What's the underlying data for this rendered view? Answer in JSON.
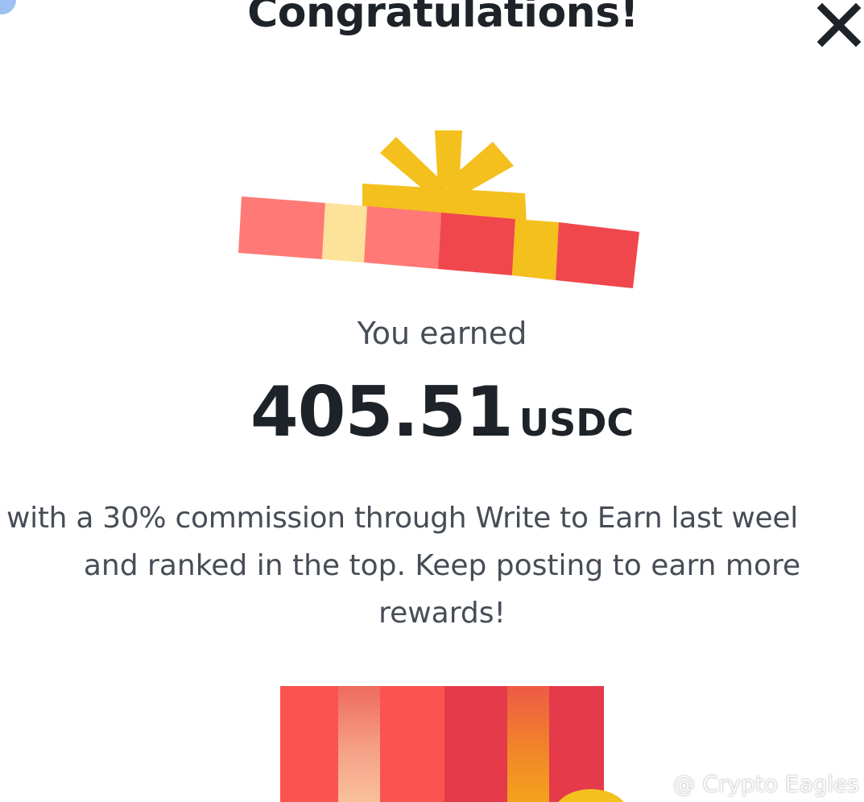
{
  "dialog": {
    "title": "Congratulations!",
    "close_icon": "close-icon"
  },
  "reward": {
    "label": "You earned",
    "amount": "405.51",
    "unit": "USDC"
  },
  "description": {
    "lines": [
      "with a 30% commission through Write to Earn last weel",
      "and ranked in the top. Keep posting to earn more",
      "rewards!"
    ]
  },
  "watermark": {
    "text": "@ Crypto Eagles",
    "icon": "binance-logo-icon"
  },
  "colors": {
    "title": "#1e2329",
    "body_text": "#474d57",
    "gift_red": "#f0474d",
    "gift_pink": "#ff7a76",
    "gift_gold": "#f4c01d",
    "gift_cream": "#fde29a"
  }
}
